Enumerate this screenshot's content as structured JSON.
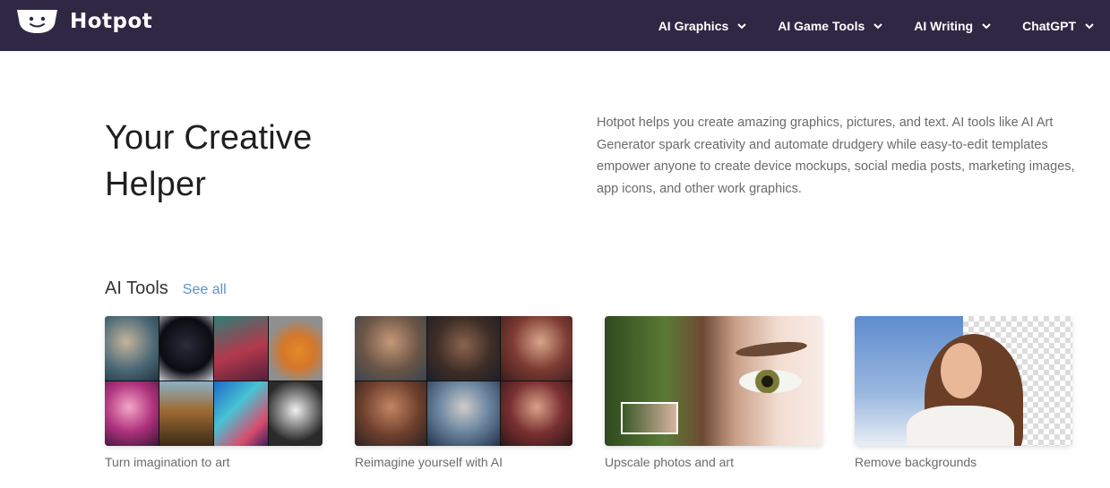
{
  "header": {
    "brand": "Hotpot",
    "nav": [
      {
        "label": "AI Graphics"
      },
      {
        "label": "AI Game Tools"
      },
      {
        "label": "AI Writing"
      },
      {
        "label": "ChatGPT"
      }
    ]
  },
  "hero": {
    "title": "Your Creative Helper",
    "description": "Hotpot helps you create amazing graphics, pictures, and text. AI tools like AI Art Generator spark creativity and automate drudgery while easy-to-edit templates empower anyone to create device mockups, social media posts, marketing images, app icons, and other work graphics."
  },
  "tools": {
    "title": "AI Tools",
    "see_all": "See all",
    "cards": [
      {
        "caption": "Turn imagination to art"
      },
      {
        "caption": "Reimagine yourself with AI"
      },
      {
        "caption": "Upscale photos and art"
      },
      {
        "caption": "Remove backgrounds"
      }
    ]
  },
  "colors": {
    "nav_bg": "#2f2844",
    "link": "#5b93c9",
    "muted_text": "#6b6b6b"
  }
}
